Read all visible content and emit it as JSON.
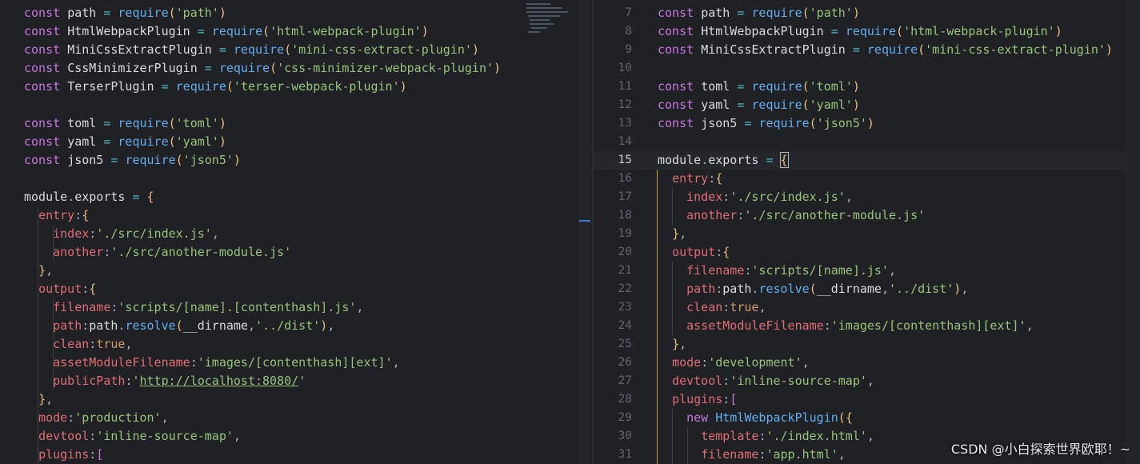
{
  "left_lines": [
    "const path = require('path')",
    "const HtmlWebpackPlugin = require('html-webpack-plugin')",
    "const MiniCssExtractPlugin = require('mini-css-extract-plugin')",
    "const CssMinimizerPlugin = require('css-minimizer-webpack-plugin')",
    "const TerserPlugin = require('terser-webpack-plugin')",
    "",
    "const toml = require('toml')",
    "const yaml = require('yaml')",
    "const json5 = require('json5')",
    "",
    "module.exports = {",
    "  entry:{",
    "    index:'./src/index.js',",
    "    another:'./src/another-module.js'",
    "  },",
    "  output:{",
    "    filename:'scripts/[name].[contenthash].js',",
    "    path:path.resolve(__dirname,'../dist'),",
    "    clean:true,",
    "    assetModuleFilename:'images/[contenthash][ext]',",
    "    publicPath:'http://localhost:8080/'",
    "  },",
    "  mode:'production',",
    "  devtool:'inline-source-map',",
    "  plugins:["
  ],
  "right_line_numbers": [
    "7",
    "8",
    "9",
    "10",
    "11",
    "12",
    "13",
    "14",
    "15",
    "16",
    "17",
    "18",
    "19",
    "20",
    "21",
    "22",
    "23",
    "24",
    "25",
    "26",
    "27",
    "28",
    "29",
    "30",
    "31"
  ],
  "right_active_line": "15",
  "right_lines": [
    "const path = require('path')",
    "const HtmlWebpackPlugin = require('html-webpack-plugin')",
    "const MiniCssExtractPlugin = require('mini-css-extract-plugin')",
    "",
    "const toml = require('toml')",
    "const yaml = require('yaml')",
    "const json5 = require('json5')",
    "",
    "module.exports = {",
    "  entry:{",
    "    index:'./src/index.js',",
    "    another:'./src/another-module.js'",
    "  },",
    "  output:{",
    "    filename:'scripts/[name].js',",
    "    path:path.resolve(__dirname,'../dist'),",
    "    clean:true,",
    "    assetModuleFilename:'images/[contenthash][ext]',",
    "  },",
    "  mode:'development',",
    "  devtool:'inline-source-map',",
    "  plugins:[",
    "    new HtmlWebpackPlugin({",
    "      template:'./index.html',",
    "      filename:'app.html',"
  ],
  "watermark": "CSDN @小白探索世界欧耶！~",
  "colors": {
    "background": "#1f2125",
    "keyword": "#c678dd",
    "string": "#98c379",
    "function": "#61afef",
    "property": "#e06c75",
    "operator": "#56b6c2"
  }
}
